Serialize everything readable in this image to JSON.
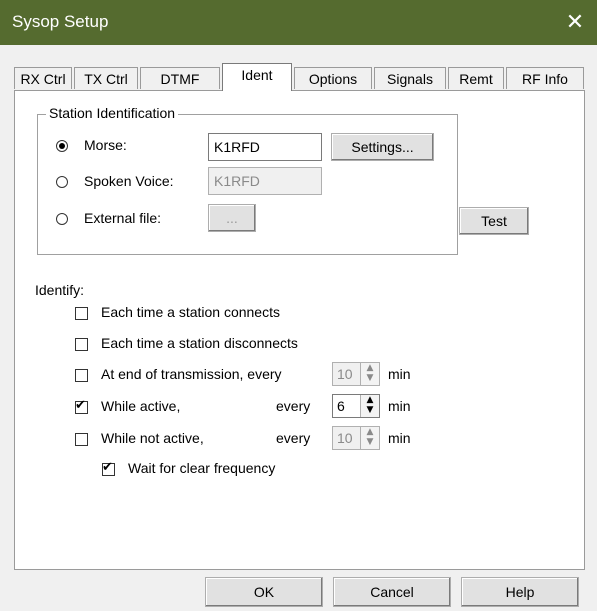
{
  "window": {
    "title": "Sysop Setup",
    "close_glyph": "✕"
  },
  "tabs": [
    {
      "label": "RX Ctrl"
    },
    {
      "label": "TX Ctrl"
    },
    {
      "label": "DTMF"
    },
    {
      "label": "Ident",
      "active": true
    },
    {
      "label": "Options"
    },
    {
      "label": "Signals"
    },
    {
      "label": "Remt"
    },
    {
      "label": "RF Info"
    }
  ],
  "station_id": {
    "group_label": "Station Identification",
    "morse": {
      "label": "Morse:",
      "value": "K1RFD",
      "selected": true
    },
    "spoken": {
      "label": "Spoken Voice:",
      "value": "K1RFD"
    },
    "external": {
      "label": "External file:",
      "button_label": "..."
    },
    "settings_label": "Settings...",
    "test_label": "Test"
  },
  "identify": {
    "label": "Identify:",
    "connect_label": "Each time a station connects",
    "disconnect_label": "Each time a station disconnects",
    "end_tx": {
      "label": "At end of transmission, every",
      "value": "10",
      "unit": "min",
      "checked": false
    },
    "active": {
      "label": "While active,",
      "every": "every",
      "value": "6",
      "unit": "min",
      "checked": true
    },
    "not_active": {
      "label": "While not active,",
      "every": "every",
      "value": "10",
      "unit": "min",
      "checked": false
    },
    "wait_clear": {
      "label": "Wait for clear frequency",
      "checked": true
    }
  },
  "footer": {
    "ok_label": "OK",
    "cancel_label": "Cancel",
    "help_label": "Help"
  },
  "colors": {
    "titlebar": "#556b2f",
    "panel_bg": "#ffffff",
    "client_bg": "#f0f0f0"
  }
}
